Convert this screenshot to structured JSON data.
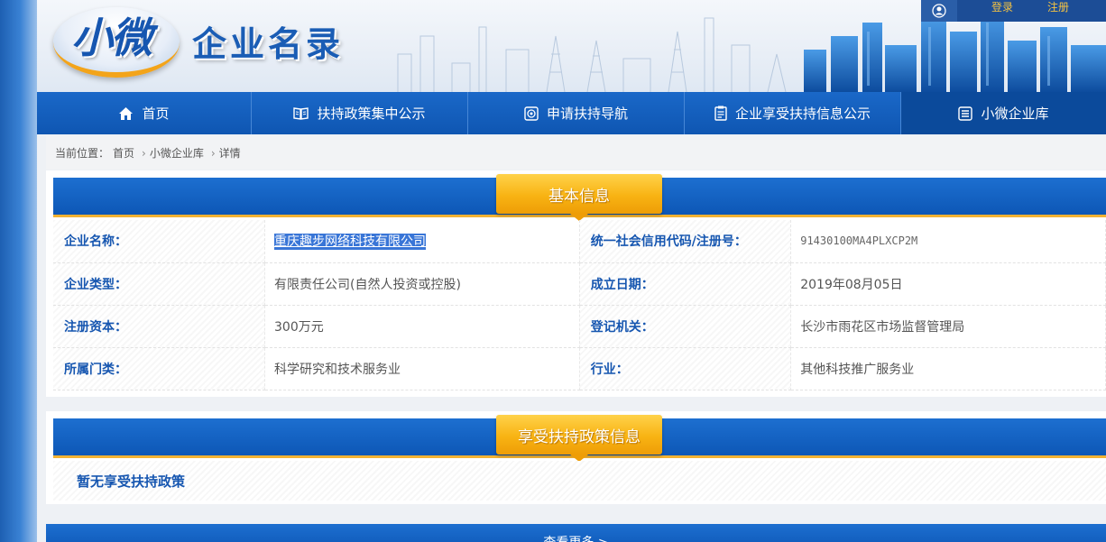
{
  "header": {
    "logo_mark": "小微",
    "logo_text": "企业名录",
    "login_label": "登录",
    "register_label": "注册"
  },
  "nav": {
    "items": [
      {
        "label": "首页",
        "icon": "home-icon"
      },
      {
        "label": "扶持政策集中公示",
        "icon": "book-icon"
      },
      {
        "label": "申请扶持导航",
        "icon": "compass-icon"
      },
      {
        "label": "企业享受扶持信息公示",
        "icon": "clipboard-icon"
      },
      {
        "label": "小微企业库",
        "icon": "list-icon"
      }
    ],
    "active_index": 4
  },
  "breadcrumb": {
    "prefix": "当前位置：",
    "items": [
      "首页",
      "小微企业库",
      "详情"
    ]
  },
  "basic_info": {
    "title": "基本信息",
    "rows": [
      {
        "l1": "企业名称：",
        "v1": "重庆趣步网络科技有限公司",
        "l2": "统一社会信用代码/注册号：",
        "v2": "91430100MA4PLXCP2M"
      },
      {
        "l1": "企业类型：",
        "v1": "有限责任公司(自然人投资或控股)",
        "l2": "成立日期：",
        "v2": "2019年08月05日"
      },
      {
        "l1": "注册资本：",
        "v1": "300万元",
        "l2": "登记机关：",
        "v2": "长沙市雨花区市场监督管理局"
      },
      {
        "l1": "所属门类：",
        "v1": "科学研究和技术服务业",
        "l2": "行业：",
        "v2": "其他科技推广服务业"
      }
    ]
  },
  "policy": {
    "title": "享受扶持政策信息",
    "empty_text": "暂无享受扶持政策"
  },
  "more": {
    "label": "查看更多 >"
  },
  "colors": {
    "brand_blue": "#0d57b6",
    "accent_orange": "#f8b313",
    "auth_link": "#f5c342"
  }
}
